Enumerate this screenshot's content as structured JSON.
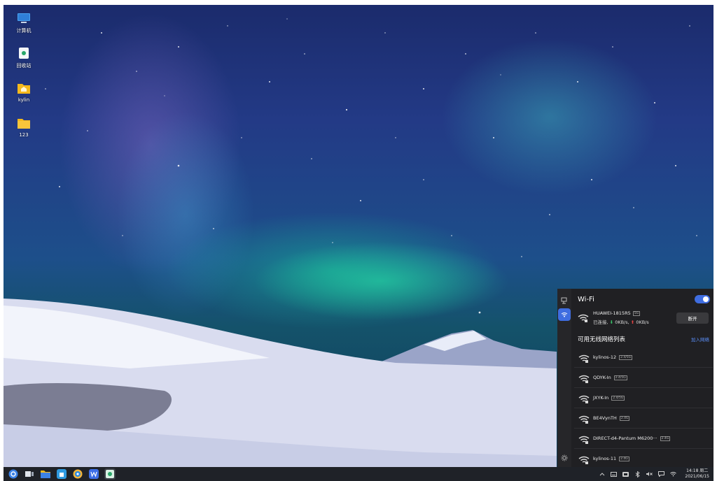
{
  "desktop_icons": [
    {
      "label": "计算机",
      "icon": "computer-icon"
    },
    {
      "label": "回收站",
      "icon": "trash-icon"
    },
    {
      "label": "kylin",
      "icon": "home-folder-icon"
    },
    {
      "label": "123",
      "icon": "folder-icon"
    }
  ],
  "taskbar": {
    "apps": [
      "start-menu-icon",
      "multitask-view-icon",
      "file-manager-icon",
      "software-store-icon",
      "browser-icon",
      "wps-writer-icon",
      "image-viewer-icon"
    ],
    "clock": {
      "time": "14:18 周二",
      "date": "2021/06/15"
    }
  },
  "wifi_panel": {
    "title": "Wi-Fi",
    "enabled": true,
    "current_network": {
      "ssid": "HUAWEI-1815R5",
      "band": "5G",
      "status": "已连接,",
      "download": "0KB/s",
      "sep": ",",
      "upload": "0KB/s",
      "disconnect_label": "断开"
    },
    "available_title": "可用无线网络列表",
    "join_label": "加入网络",
    "networks": [
      {
        "ssid": "kylinos-12",
        "band": "2.4/5G"
      },
      {
        "ssid": "QDYK-In",
        "band": "2.4/5G"
      },
      {
        "ssid": "JXYK-In",
        "band": "2.4/5G"
      },
      {
        "ssid": "BE4VynTH",
        "band": "2.4G"
      },
      {
        "ssid": "DIRECT-d4-Pantum M6200···",
        "band": "2.4G"
      },
      {
        "ssid": "kylinos-11",
        "band": "2.4G"
      }
    ]
  },
  "colors": {
    "accent": "#3f6de0",
    "panel_bg": "#202023",
    "taskbar_bg": "#1f2228",
    "link": "#5a8df5"
  }
}
